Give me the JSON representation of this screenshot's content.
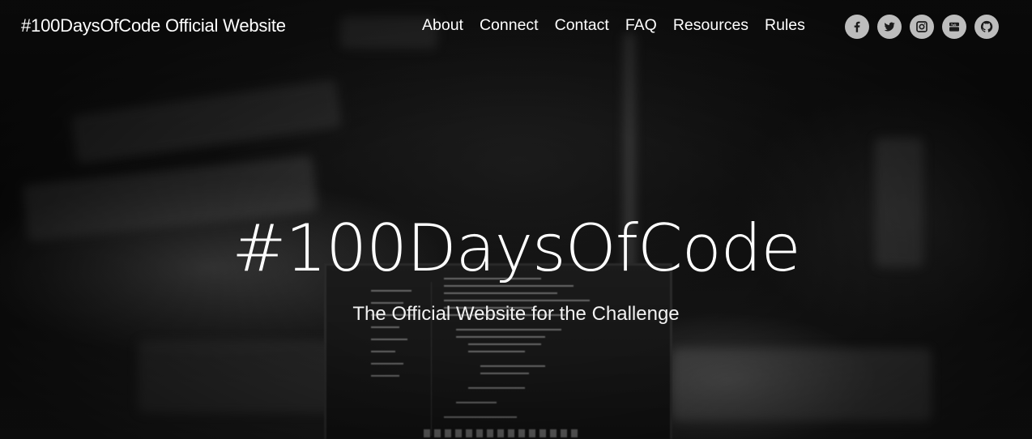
{
  "header": {
    "brand": "#100DaysOfCode Official Website",
    "nav": [
      {
        "label": "About"
      },
      {
        "label": "Connect"
      },
      {
        "label": "Contact"
      },
      {
        "label": "FAQ"
      },
      {
        "label": "Resources"
      },
      {
        "label": "Rules"
      }
    ],
    "social_icons": [
      "facebook-icon",
      "twitter-icon",
      "instagram-icon",
      "youtube-icon",
      "github-icon"
    ]
  },
  "hero": {
    "title": "#100DaysOfCode",
    "subtitle": "The Official Website for the Challenge"
  },
  "colors": {
    "background": "#0b0b0b",
    "text": "#ffffff",
    "icon_circle": "#bdbdbd"
  }
}
